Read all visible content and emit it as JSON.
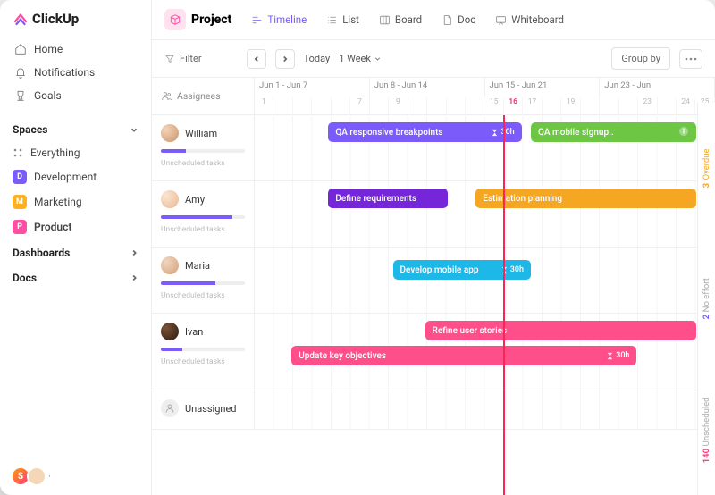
{
  "app_name": "ClickUp",
  "nav": {
    "home": "Home",
    "notifications": "Notifications",
    "goals": "Goals"
  },
  "spaces_header": "Spaces",
  "spaces": {
    "everything": "Everything",
    "dev": {
      "badge": "D",
      "label": "Development",
      "color": "#7B5CFA"
    },
    "mkt": {
      "badge": "M",
      "label": "Marketing",
      "color": "#FFB020"
    },
    "prod": {
      "badge": "P",
      "label": "Product",
      "color": "#FF4FA3"
    }
  },
  "dashboards_header": "Dashboards",
  "docs_header": "Docs",
  "presence_initial": "S",
  "project_title": "Project",
  "views": {
    "timeline": "Timeline",
    "list": "List",
    "board": "Board",
    "doc": "Doc",
    "whiteboard": "Whiteboard"
  },
  "toolbar": {
    "filter": "Filter",
    "today": "Today",
    "range": "1 Week",
    "groupby": "Group by"
  },
  "timeline_left": "Assignees",
  "weeks": [
    "Jun 1 - Jun 7",
    "Jun 8 - Jun 14",
    "Jun 15 - Jun 21",
    "Jun 23 - Jun"
  ],
  "days": [
    "1",
    "",
    "",
    "",
    "",
    "7",
    "",
    "9",
    "",
    "",
    "",
    "",
    "15",
    "16",
    "17",
    "",
    "19",
    "",
    "",
    "",
    "23",
    "",
    "24",
    "25"
  ],
  "today_index": 13,
  "unscheduled_label": "Unscheduled tasks",
  "assignees": {
    "william": {
      "name": "William",
      "progress": 30
    },
    "amy": {
      "name": "Amy",
      "progress": 85
    },
    "maria": {
      "name": "Maria",
      "progress": 65
    },
    "ivan": {
      "name": "Ivan",
      "progress": 25
    },
    "unassigned": {
      "name": "Unassigned"
    }
  },
  "tasks": {
    "qa_resp": {
      "label": "QA responsive breakpoints",
      "hours": "30h"
    },
    "qa_mobile": {
      "label": "QA mobile signup.."
    },
    "define_req": {
      "label": "Define requirements"
    },
    "estimation": {
      "label": "Estimation planning"
    },
    "dev_mobile": {
      "label": "Develop mobile app",
      "hours": "30h"
    },
    "refine": {
      "label": "Refine user stories"
    },
    "update": {
      "label": "Update key objectives",
      "hours": "30h"
    }
  },
  "rail": {
    "overdue": {
      "count": "3",
      "label": "Overdue"
    },
    "noeffort": {
      "count": "2",
      "label": "No effort"
    },
    "unsched": {
      "count": "140",
      "label": "Unscheduled"
    }
  }
}
